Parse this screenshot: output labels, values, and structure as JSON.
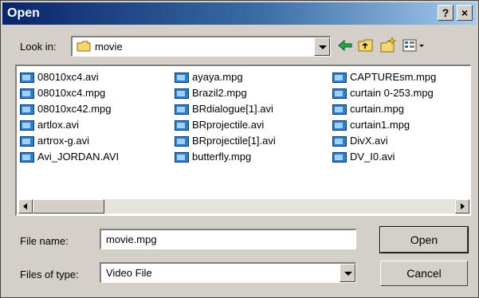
{
  "window": {
    "title": "Open"
  },
  "titlebar": {
    "help_label": "?",
    "close_label": "×"
  },
  "lookin": {
    "label": "Look in:",
    "value": "movie"
  },
  "toolbar": {
    "back_icon": "back-arrow-icon",
    "up_icon": "up-folder-icon",
    "newfolder_icon": "new-folder-icon",
    "view_icon": "view-menu-icon"
  },
  "files": {
    "col1": [
      "08010xc4.avi",
      "08010xc4.mpg",
      "08010xc42.mpg",
      "artlox.avi",
      "artrox-g.avi",
      "Avi_JORDAN.AVI"
    ],
    "col2": [
      "ayaya.mpg",
      "Brazil2.mpg",
      "BRdialogue[1].avi",
      "BRprojectile.avi",
      "BRprojectile[1].avi",
      "butterfly.mpg"
    ],
    "col3": [
      "CAPTUREsm.mpg",
      "curtain 0-253.mpg",
      "curtain.mpg",
      "curtain1.mpg",
      "DivX.avi",
      "DV_I0.avi"
    ]
  },
  "filename": {
    "label": "File name:",
    "value": "movie.mpg"
  },
  "filetype": {
    "label": "Files of type:",
    "value": "Video File"
  },
  "buttons": {
    "open": "Open",
    "cancel": "Cancel"
  },
  "colors": {
    "titlebar": "#0a246a",
    "face": "#d4d0c8"
  }
}
